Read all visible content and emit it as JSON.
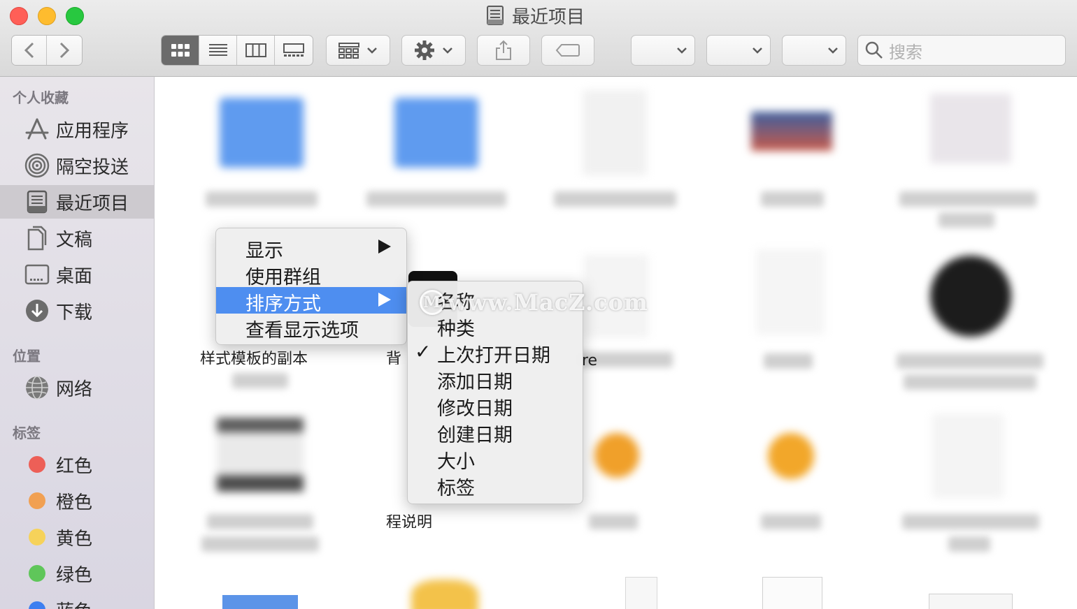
{
  "window": {
    "title": "最近项目"
  },
  "toolbar": {
    "search_placeholder": "搜索"
  },
  "sidebar": {
    "sections": {
      "favorites": "个人收藏",
      "locations": "位置",
      "tags": "标签"
    },
    "favorites": [
      {
        "label": "应用程序",
        "icon": "applications-icon"
      },
      {
        "label": "隔空投送",
        "icon": "airdrop-icon"
      },
      {
        "label": "最近项目",
        "icon": "recents-icon",
        "selected": true
      },
      {
        "label": "文稿",
        "icon": "documents-icon"
      },
      {
        "label": "桌面",
        "icon": "desktop-icon"
      },
      {
        "label": "下载",
        "icon": "downloads-icon"
      }
    ],
    "locations": [
      {
        "label": "网络",
        "icon": "network-icon"
      }
    ],
    "tags": [
      {
        "label": "红色",
        "color": "#ed5f57"
      },
      {
        "label": "橙色",
        "color": "#f1a052"
      },
      {
        "label": "黄色",
        "color": "#f6d25a"
      },
      {
        "label": "绿色",
        "color": "#5fc65a"
      },
      {
        "label": "蓝色",
        "color": "#3d7ff0"
      }
    ]
  },
  "content": {
    "partial_labels": [
      "样式模板的副本",
      "背",
      "re",
      "程说明"
    ]
  },
  "context_menu": {
    "items": [
      "显示",
      "使用群组",
      "排序方式",
      "查看显示选项"
    ],
    "highlighted": "排序方式"
  },
  "sort_submenu": {
    "items": [
      "名称",
      "种类",
      "上次打开日期",
      "添加日期",
      "修改日期",
      "创建日期",
      "大小",
      "标签"
    ],
    "checked": "上次打开日期"
  },
  "watermark": "www.MacZ.com"
}
